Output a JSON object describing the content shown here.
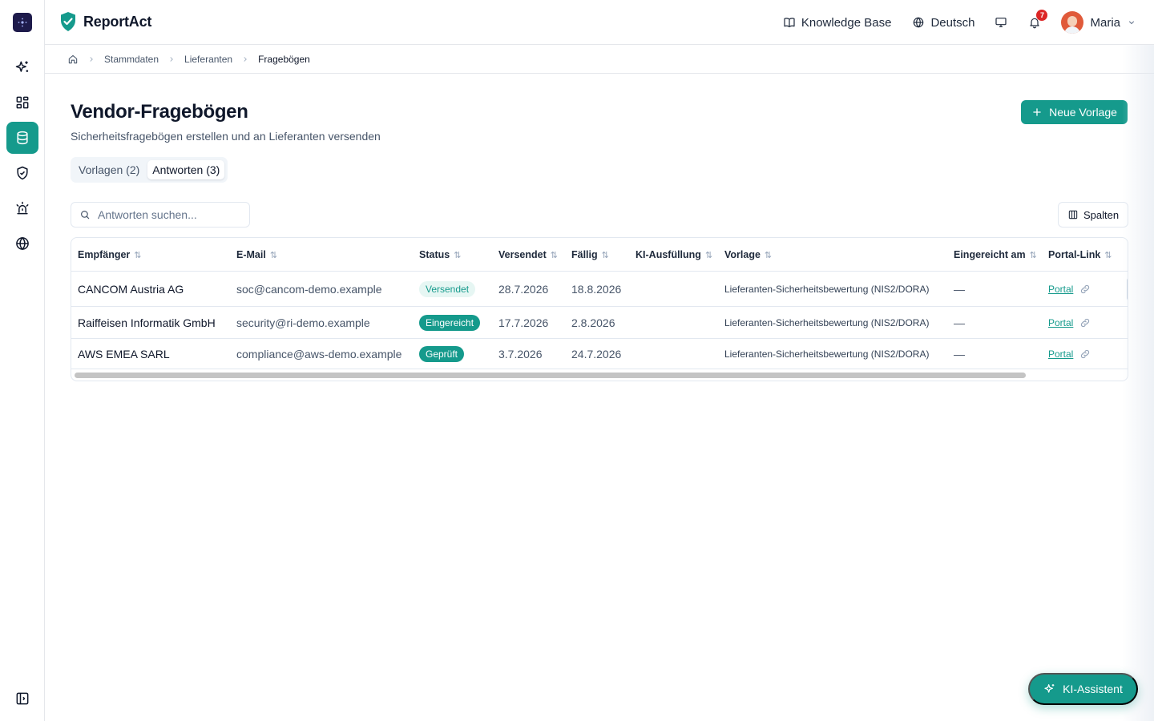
{
  "brand": {
    "name": "ReportAct"
  },
  "header": {
    "knowledge_base": "Knowledge Base",
    "language": "Deutsch",
    "notification_count": "7",
    "user_name": "Maria"
  },
  "breadcrumb": [
    "Stammdaten",
    "Lieferanten",
    "Fragebögen"
  ],
  "page": {
    "title": "Vendor-Fragebögen",
    "subtitle": "Sicherheitsfragebögen erstellen und an Lieferanten versenden",
    "new_button": "Neue Vorlage"
  },
  "tabs": [
    {
      "label": "Vorlagen (2)",
      "active": false
    },
    {
      "label": "Antworten (3)",
      "active": true
    }
  ],
  "search": {
    "placeholder": "Antworten suchen..."
  },
  "columns_button": "Spalten",
  "table": {
    "headers": [
      "Empfänger",
      "E-Mail",
      "Status",
      "Versendet",
      "Fällig",
      "KI-Ausfüllung",
      "Vorlage",
      "Eingereicht am",
      "Portal-Link"
    ],
    "rows": [
      {
        "recipient": "CANCOM Austria AG",
        "email": "soc@cancom-demo.example",
        "status": "Versendet",
        "sent": "28.7.2026",
        "due": "18.8.2026",
        "ai_fill": "",
        "template": "Lieferanten-Sicherheitsbewertung (NIS2/DORA)",
        "submitted": "—",
        "portal": "Portal"
      },
      {
        "recipient": "Raiffeisen Informatik GmbH",
        "email": "security@ri-demo.example",
        "status": "Eingereicht",
        "sent": "17.7.2026",
        "due": "2.8.2026",
        "ai_fill": "",
        "template": "Lieferanten-Sicherheitsbewertung (NIS2/DORA)",
        "submitted": "—",
        "portal": "Portal"
      },
      {
        "recipient": "AWS EMEA SARL",
        "email": "compliance@aws-demo.example",
        "status": "Geprüft",
        "sent": "3.7.2026",
        "due": "24.7.2026",
        "ai_fill": "",
        "template": "Lieferanten-Sicherheitsbewertung (NIS2/DORA)",
        "submitted": "—",
        "portal": "Portal"
      }
    ]
  },
  "assistant_button": "KI-Assistent",
  "colors": {
    "accent": "#159a8c",
    "badge": "#dc2626",
    "logo_bg": "#1e1b4b"
  }
}
